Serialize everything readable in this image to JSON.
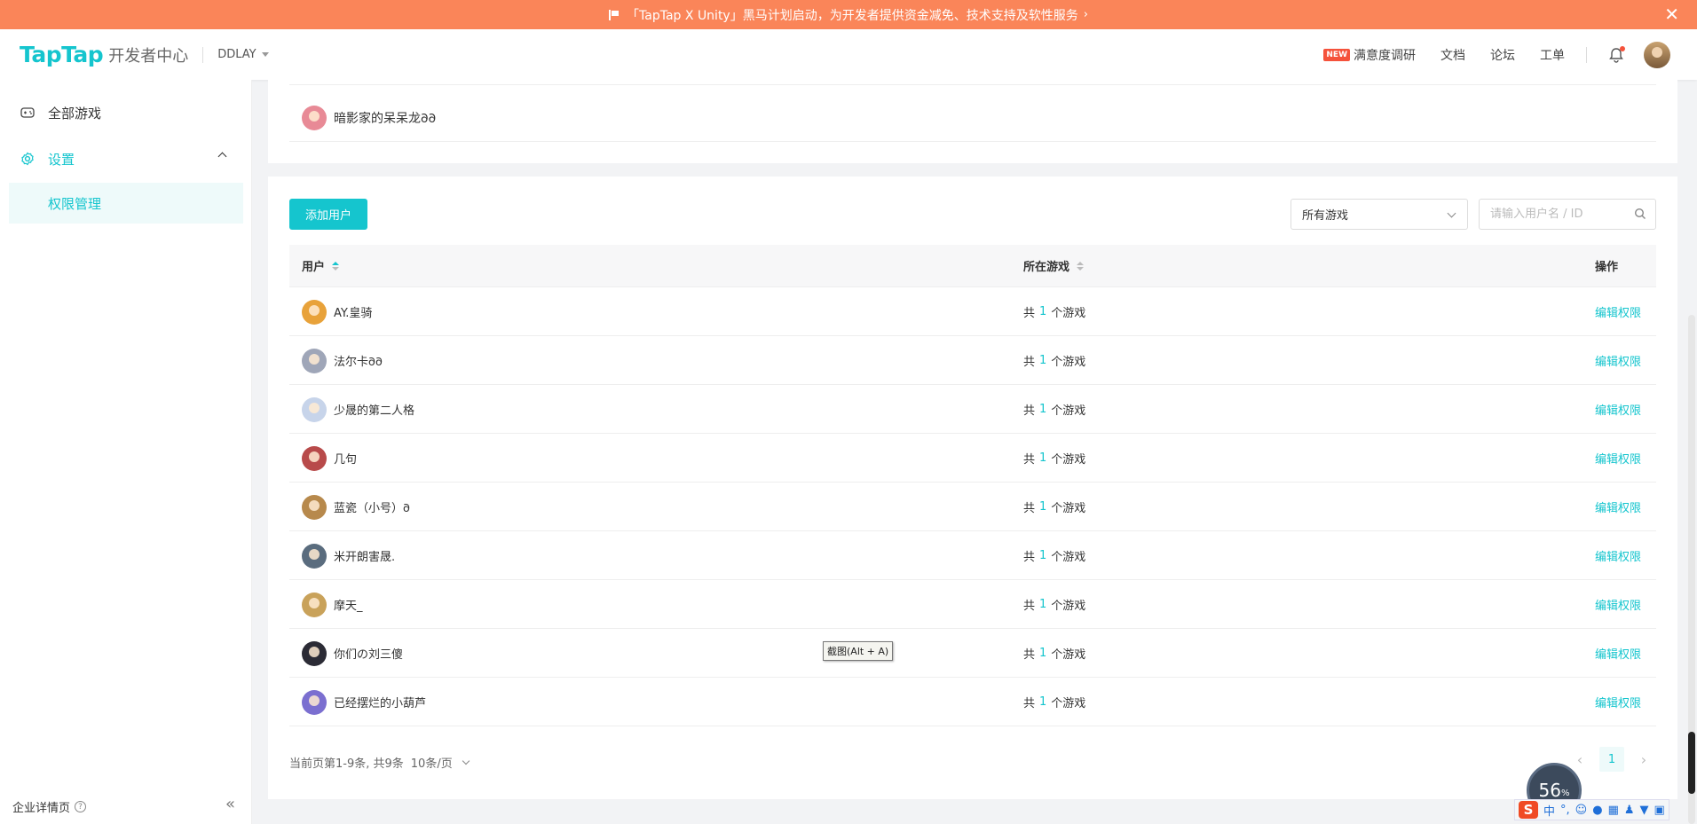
{
  "banner": {
    "text": "「TapTap X Unity」黑马计划启动，为开发者提供资金减免、技术支持及软性服务",
    "close": "✕"
  },
  "header": {
    "logo": "TapTap",
    "logo_sub": "开发者中心",
    "org": "DDLAY",
    "new_badge": "NEW",
    "links": [
      "满意度调研",
      "文档",
      "论坛",
      "工单"
    ]
  },
  "sidebar": {
    "items": [
      {
        "label": "全部游戏",
        "icon": "gamepad-icon"
      },
      {
        "label": "设置",
        "icon": "gear-icon"
      },
      {
        "label": "权限管理"
      }
    ],
    "bottom_label": "企业详情页",
    "help": "?",
    "collapse": "«"
  },
  "top_card": {
    "row_label": "暗影家的呆呆龙𐐀𐐀"
  },
  "toolbar": {
    "add_label": "添加用户",
    "game_filter": "所有游戏",
    "search_placeholder": "请输入用户名 / ID"
  },
  "table": {
    "headers": {
      "user": "用户",
      "games": "所在游戏",
      "actions": "操作"
    },
    "games_prefix": "共",
    "games_suffix": "个游戏",
    "action_label": "编辑权限",
    "rows": [
      {
        "name": "AY.皇骑",
        "games": "1",
        "color": "#e8a23a"
      },
      {
        "name": "法尔卡𐐀𐐀",
        "games": "1",
        "color": "#9fa6b8"
      },
      {
        "name": "少晟的第二人格",
        "games": "1",
        "color": "#c7d4ea"
      },
      {
        "name": "几句",
        "games": "1",
        "color": "#b84a4a"
      },
      {
        "name": "蓝瓷（小号）𐐀",
        "games": "1",
        "color": "#b7894c"
      },
      {
        "name": "米开朗害晟.",
        "games": "1",
        "color": "#5a6c7e"
      },
      {
        "name": "摩天_",
        "games": "1",
        "color": "#c9a25a"
      },
      {
        "name": "你们の刘三傻",
        "games": "1",
        "color": "#2b2b35"
      },
      {
        "name": "已经摆烂的小葫芦",
        "games": "1",
        "color": "#7b6fd0"
      }
    ]
  },
  "footer": {
    "summary": "当前页第1-9条, 共9条",
    "page_size": "10条/页",
    "page": "1"
  },
  "tooltip": "截图(Alt + A)",
  "speed": {
    "value": "56",
    "unit": "%"
  },
  "ime": {
    "mode": "中",
    "punct": "°,",
    "logo": "S"
  },
  "colors": {
    "accent": "#15c5ce",
    "banner": "#fa8559",
    "badge": "#f5523b"
  }
}
